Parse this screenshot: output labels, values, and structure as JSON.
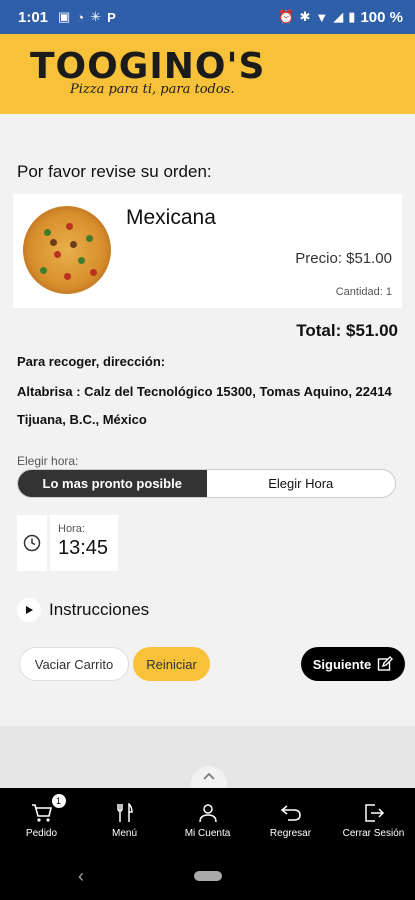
{
  "status_bar": {
    "time": "1:01",
    "left_icons": [
      "image-icon",
      "whatsapp-icon",
      "settings-icon",
      "p-icon"
    ],
    "right_icons": [
      "alarm-icon",
      "bluetooth-icon",
      "wifi-icon",
      "signal-icon",
      "battery-icon"
    ],
    "battery": "100 %"
  },
  "header": {
    "brand": "TOOGINO'S",
    "tagline": "Pizza para ti, para todos."
  },
  "order": {
    "title": "Por favor revise su orden:",
    "item": {
      "name": "Mexicana",
      "price": "Precio: $51.00",
      "quantity": "Cantidad: 1"
    },
    "total": "Total: $51.00"
  },
  "pickup": {
    "label": "Para recoger, dirección:",
    "address": "Altabrisa : Calz del Tecnológico 15300, Tomas Aquino, 22414 Tijuana, B.C., México"
  },
  "time_choice": {
    "label": "Elegir hora:",
    "options": [
      "Lo mas pronto posible",
      "Elegir Hora"
    ],
    "selected": "Lo mas pronto posible",
    "time_label": "Hora:",
    "time_value": "13:45"
  },
  "instructions": {
    "label": "Instrucciones"
  },
  "buttons": {
    "empty_cart": "Vaciar Carrito",
    "reset": "Reiniciar",
    "next": "Siguiente"
  },
  "bottom_nav": {
    "items": [
      {
        "label": "Pedido",
        "icon": "cart-icon",
        "badge": "1"
      },
      {
        "label": "Menú",
        "icon": "cutlery-icon"
      },
      {
        "label": "Mi Cuenta",
        "icon": "user-icon"
      },
      {
        "label": "Regresar",
        "icon": "back-arrow-icon"
      },
      {
        "label": "Cerrar Sesión",
        "icon": "logout-icon"
      }
    ]
  },
  "colors": {
    "accent": "#f7c23a",
    "status_bar": "#2f5fa8",
    "nav_bg": "#000000"
  }
}
